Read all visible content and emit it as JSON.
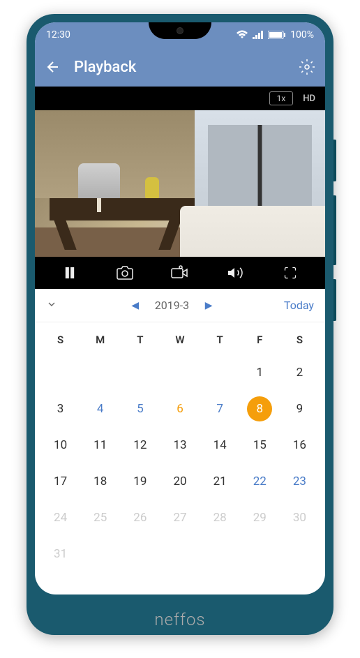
{
  "statusBar": {
    "time": "12:30",
    "battery": "100%"
  },
  "header": {
    "title": "Playback"
  },
  "videoControlsTop": {
    "speed": "1x",
    "quality": "HD"
  },
  "calendar": {
    "monthLabel": "2019-3",
    "todayLabel": "Today",
    "dayHeaders": [
      "S",
      "M",
      "T",
      "W",
      "T",
      "F",
      "S"
    ],
    "days": [
      {
        "day": "",
        "type": "empty"
      },
      {
        "day": "",
        "type": "empty"
      },
      {
        "day": "",
        "type": "empty"
      },
      {
        "day": "",
        "type": "empty"
      },
      {
        "day": "",
        "type": "empty"
      },
      {
        "day": "1",
        "type": "current-month"
      },
      {
        "day": "2",
        "type": "current-month"
      },
      {
        "day": "3",
        "type": "current-month"
      },
      {
        "day": "4",
        "type": "has-recording"
      },
      {
        "day": "5",
        "type": "has-recording"
      },
      {
        "day": "6",
        "type": "highlight-orange"
      },
      {
        "day": "7",
        "type": "has-recording"
      },
      {
        "day": "8",
        "type": "selected"
      },
      {
        "day": "9",
        "type": "current-month"
      },
      {
        "day": "10",
        "type": "current-month"
      },
      {
        "day": "11",
        "type": "current-month"
      },
      {
        "day": "12",
        "type": "current-month"
      },
      {
        "day": "13",
        "type": "current-month"
      },
      {
        "day": "14",
        "type": "current-month"
      },
      {
        "day": "15",
        "type": "current-month"
      },
      {
        "day": "16",
        "type": "current-month"
      },
      {
        "day": "17",
        "type": "current-month"
      },
      {
        "day": "18",
        "type": "current-month"
      },
      {
        "day": "19",
        "type": "current-month"
      },
      {
        "day": "20",
        "type": "current-month"
      },
      {
        "day": "21",
        "type": "current-month"
      },
      {
        "day": "22",
        "type": "has-recording"
      },
      {
        "day": "23",
        "type": "has-recording"
      },
      {
        "day": "24",
        "type": "other-month"
      },
      {
        "day": "25",
        "type": "other-month"
      },
      {
        "day": "26",
        "type": "other-month"
      },
      {
        "day": "27",
        "type": "other-month"
      },
      {
        "day": "28",
        "type": "other-month"
      },
      {
        "day": "29",
        "type": "other-month"
      },
      {
        "day": "30",
        "type": "other-month"
      },
      {
        "day": "31",
        "type": "other-month"
      }
    ]
  },
  "brand": "neffos"
}
